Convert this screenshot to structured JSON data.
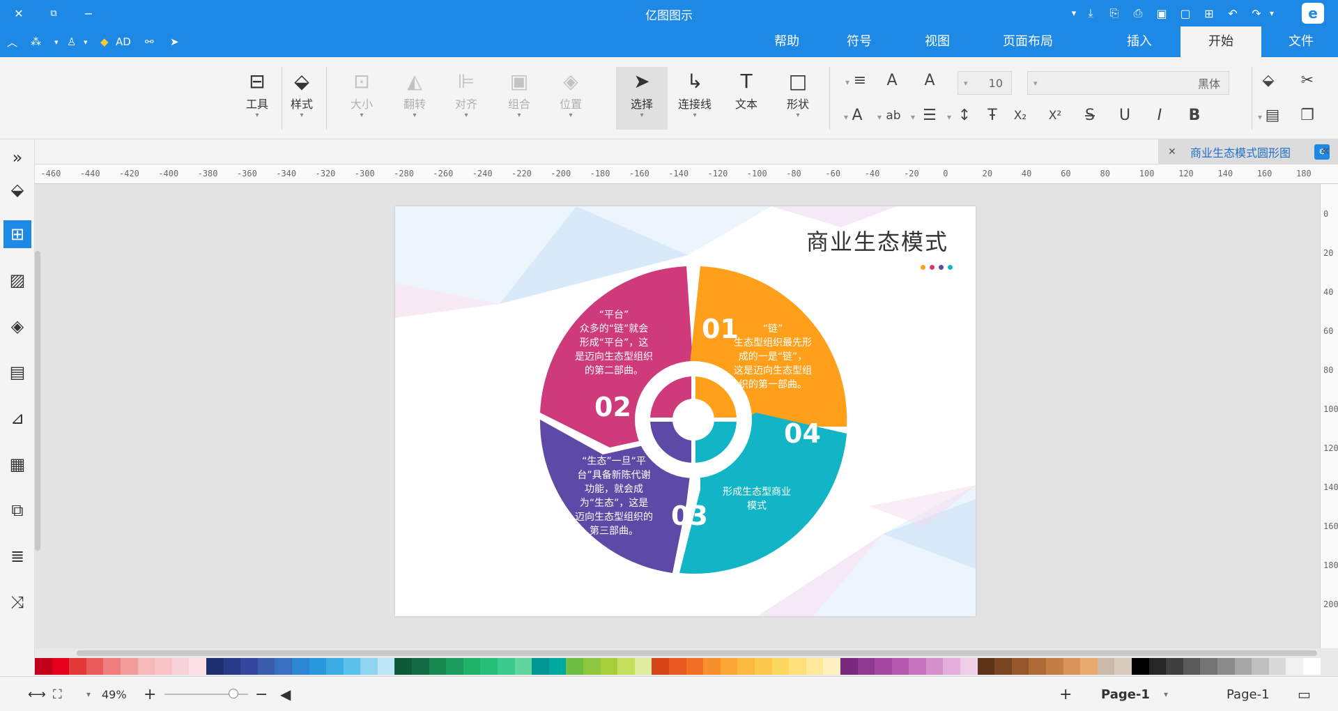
{
  "window": {
    "title": "亿图图示",
    "quick_access": [
      "↶",
      "↷",
      "+",
      "□",
      "▣",
      "⎙",
      "⤓",
      "▾"
    ]
  },
  "menu": {
    "tabs": [
      "文件",
      "开始",
      "插入",
      "页面布局",
      "视图",
      "符号",
      "帮助"
    ],
    "active_tab": "开始",
    "quick": {
      "ad": "AD"
    }
  },
  "ribbon": {
    "font_name": "黑体",
    "font_size": "10",
    "buttons": [
      {
        "label": "形状",
        "icon": "□"
      },
      {
        "label": "文本",
        "icon": "T"
      },
      {
        "label": "连接线",
        "icon": "↳"
      },
      {
        "label": "选择",
        "icon": "➤"
      },
      {
        "label": "位置",
        "icon": "◈"
      },
      {
        "label": "组合",
        "icon": "▣"
      },
      {
        "label": "对齐",
        "icon": "⊫"
      },
      {
        "label": "翻转",
        "icon": "◭"
      },
      {
        "label": "大小",
        "icon": "⊡"
      },
      {
        "label": "样式",
        "icon": "⬙"
      },
      {
        "label": "工具",
        "icon": "⊟"
      }
    ]
  },
  "document": {
    "tab_label": "商业生态模式圆形图",
    "page_title": "商业生态模式",
    "segments": [
      {
        "num": "01",
        "text": [
          "“链”",
          "生态型组织最先形",
          "成的一是“链”，",
          "这是迈向生态型组",
          "织的第一部曲。"
        ],
        "color": "#ff9f1a"
      },
      {
        "num": "02",
        "text": [
          "“平台”",
          "众多的“链”就会",
          "形成“平台”，这",
          "是迈向生态型组织",
          "的第二部曲。"
        ],
        "color": "#cf3a7a"
      },
      {
        "num": "03",
        "text": [
          "“生态”一旦“平",
          "台”具备新陈代谢",
          "功能，就会成",
          "为“生态”，这是",
          "迈向生态型组织的",
          "第三部曲。"
        ],
        "color": "#5c4aa6"
      },
      {
        "num": "04",
        "text": [
          "形成生态型商业",
          "模式"
        ],
        "color": "#12b5c5"
      }
    ],
    "dot_colors": [
      "#ff9f1a",
      "#cf3a7a",
      "#5c4aa6",
      "#12b5c5"
    ]
  },
  "ruler": {
    "h_ticks": [
      "180",
      "160",
      "140",
      "120",
      "100",
      "80",
      "60",
      "40",
      "20",
      "0",
      "-20",
      "-40",
      "-60",
      "-80",
      "-100",
      "-120",
      "-140",
      "-160",
      "-180",
      "-200",
      "-220",
      "-240",
      "-260",
      "-280",
      "-300",
      "-320",
      "-340",
      "-360",
      "-380",
      "-400",
      "-420",
      "-440",
      "-460"
    ],
    "v_ticks": [
      "0",
      "20",
      "40",
      "60",
      "80",
      "100",
      "120",
      "140",
      "160",
      "180",
      "200"
    ]
  },
  "status": {
    "page_name": "Page-1",
    "page_tab": "Page-1",
    "zoom": "49%"
  },
  "palette": [
    "#c0001a",
    "#e6001e",
    "#e23a3a",
    "#e85c5c",
    "#ef7f7f",
    "#f29c9c",
    "#f6b9b9",
    "#f8c6c6",
    "#f7d0d8",
    "#fbe0e6",
    "#1e2f6e",
    "#273b8a",
    "#33479d",
    "#3b5bab",
    "#3a6fc0",
    "#2c86d3",
    "#2a98dc",
    "#3aaee2",
    "#5cc2eb",
    "#8fd5f1",
    "#bde6f6",
    "#0e5a3a",
    "#126b45",
    "#178a52",
    "#1b9e5d",
    "#20b36a",
    "#26c07c",
    "#3bcb8f",
    "#62d49f",
    "#00968f",
    "#00a99d",
    "#6fbe44",
    "#8dc63f",
    "#a6ce39",
    "#c5e05c",
    "#e0eda0",
    "#d64515",
    "#e85a20",
    "#f26f25",
    "#f7902c",
    "#fba634",
    "#fcb93f",
    "#fdc94d",
    "#fdd85e",
    "#fee07a",
    "#ffe99b",
    "#fff2c0",
    "#7a2a7e",
    "#8f3a8f",
    "#a3479f",
    "#b55aae",
    "#c772bd",
    "#d591cc",
    "#e2b0da",
    "#efcfe8",
    "#5c3317",
    "#7a4522",
    "#94562b",
    "#ad6a36",
    "#c47f45",
    "#d99559",
    "#e9ab6f",
    "#c9b9a8",
    "#d7cbbe",
    "#000000",
    "#262626",
    "#404040",
    "#595959",
    "#737373",
    "#8c8c8c",
    "#a6a6a6",
    "#bfbfbf",
    "#d9d9d9",
    "#f2f2f2",
    "#ffffff"
  ]
}
